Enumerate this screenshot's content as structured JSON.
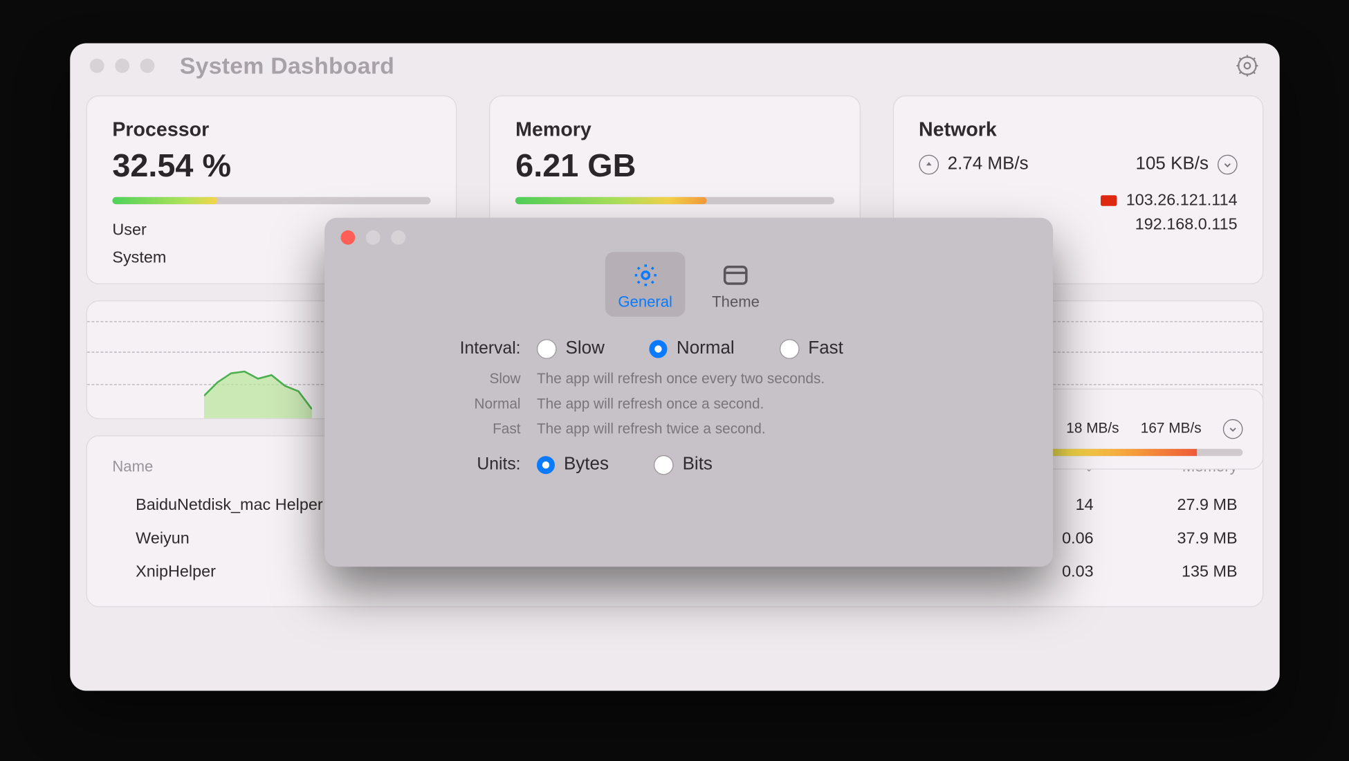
{
  "window": {
    "title": "System Dashboard"
  },
  "processor": {
    "title": "Processor",
    "value": "32.54 %",
    "kv": {
      "user": "User",
      "system": "System"
    }
  },
  "memory": {
    "title": "Memory",
    "value": "6.21 GB"
  },
  "network": {
    "title": "Network",
    "up_rate": "2.74 MB/s",
    "down_rate": "105 KB/s",
    "public_ip": "103.26.121.114",
    "local_ip": "192.168.0.115"
  },
  "disk_fragment": {
    "read": "18 MB/s",
    "write": "167 MB/s"
  },
  "proc_table": {
    "headers": {
      "name": "Name",
      "memory": "Memory"
    },
    "rows": [
      {
        "name": "BaiduNetdisk_mac Helper",
        "val": "14",
        "mem": "27.9 MB"
      },
      {
        "name": "Weiyun",
        "val": "0.06",
        "mem": "37.9 MB"
      },
      {
        "name": "XnipHelper",
        "val": "0.03",
        "mem": "135 MB"
      }
    ]
  },
  "prefs": {
    "tabs": {
      "general": "General",
      "theme": "Theme"
    },
    "interval": {
      "label": "Interval:",
      "options": {
        "slow": "Slow",
        "normal": "Normal",
        "fast": "Fast"
      },
      "selected": "normal",
      "desc": {
        "slow": {
          "k": "Slow",
          "v": "The app will refresh once every two seconds."
        },
        "normal": {
          "k": "Normal",
          "v": "The app will refresh once a second."
        },
        "fast": {
          "k": "Fast",
          "v": "The app will refresh twice a second."
        }
      }
    },
    "units": {
      "label": "Units:",
      "options": {
        "bytes": "Bytes",
        "bits": "Bits"
      },
      "selected": "bytes"
    }
  }
}
